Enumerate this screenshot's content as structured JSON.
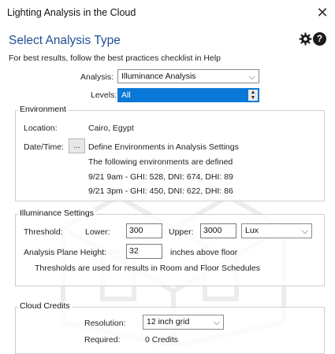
{
  "window": {
    "title": "Lighting Analysis in the Cloud"
  },
  "header": {
    "heading": "Select Analysis Type",
    "subtitle": "For best results, follow the best practices checklist in Help"
  },
  "analysis": {
    "analysis_label": "Analysis:",
    "analysis_value": "Illuminance Analysis",
    "levels_label": "Levels:",
    "levels_value": "All"
  },
  "environment": {
    "group_title": "Environment",
    "location_label": "Location:",
    "location_value": "Cairo, Egypt",
    "datetime_label": "Date/Time:",
    "browse_label": "...",
    "datetime_value": "Define Environments in Analysis Settings",
    "defined_note": "The following environments are defined",
    "env_lines": [
      "9/21 9am - GHI: 528, DNI: 674, DHI: 89",
      "9/21 3pm - GHI: 450, DNI: 622, DHI: 86"
    ]
  },
  "illuminance": {
    "group_title": "Illuminance Settings",
    "threshold_label": "Threshold:",
    "lower_label": "Lower:",
    "lower_value": "300",
    "upper_label": "Upper:",
    "upper_value": "3000",
    "unit_value": "Lux",
    "plane_label": "Analysis Plane Height:",
    "plane_value": "32",
    "plane_unit": "inches above floor",
    "note": "Thresholds are used for results in Room and Floor Schedules"
  },
  "credits": {
    "group_title": "Cloud Credits",
    "resolution_label": "Resolution:",
    "resolution_value": "12 inch grid",
    "required_label": "Required:",
    "required_value": "0 Credits"
  },
  "icons": [
    "close-icon",
    "gear-icon",
    "help-icon",
    "chevron-down-icon",
    "spin-updown-icon"
  ],
  "colors": {
    "heading": "#1f4e96",
    "selection": "#0a78d7"
  }
}
